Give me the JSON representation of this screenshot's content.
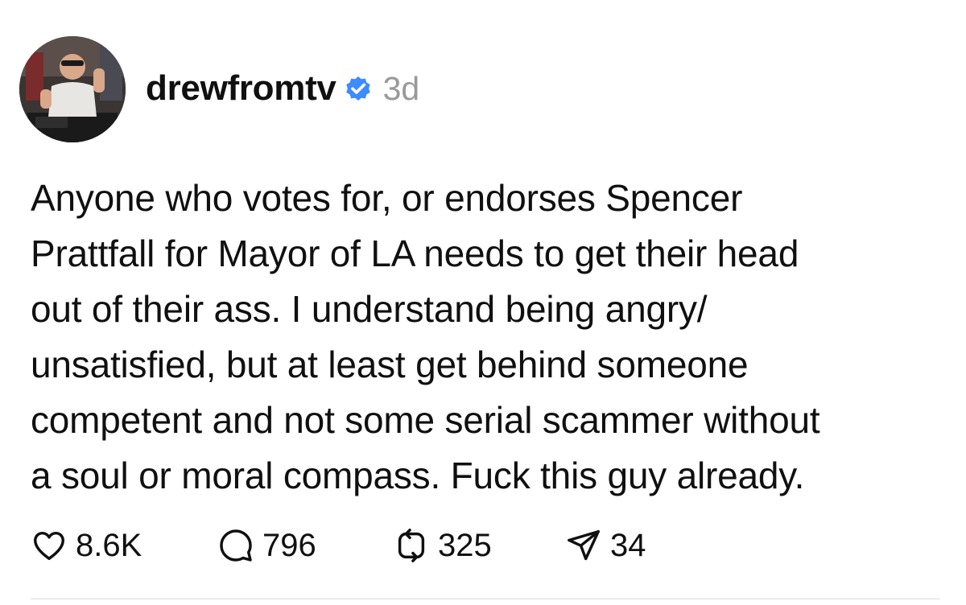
{
  "post": {
    "username": "drewfromtv",
    "verified": true,
    "verified_icon": "verified-badge-icon",
    "verified_color": "#3d8bfd",
    "timestamp": "3d",
    "avatar": "user-avatar",
    "text": "Anyone who votes for, or endorses Spencer\nPrattfall for Mayor of LA needs to get their head\nout of their ass. I understand being angry/\nunsatisfied, but at least get behind someone\ncompetent and not some serial scammer without\na soul or moral compass. Fuck this guy already."
  },
  "actions": {
    "like": {
      "icon": "heart-icon",
      "count": "8.6K"
    },
    "reply": {
      "icon": "speech-bubble-icon",
      "count": "796"
    },
    "repost": {
      "icon": "repost-icon",
      "count": "325"
    },
    "share": {
      "icon": "send-icon",
      "count": "34"
    }
  }
}
